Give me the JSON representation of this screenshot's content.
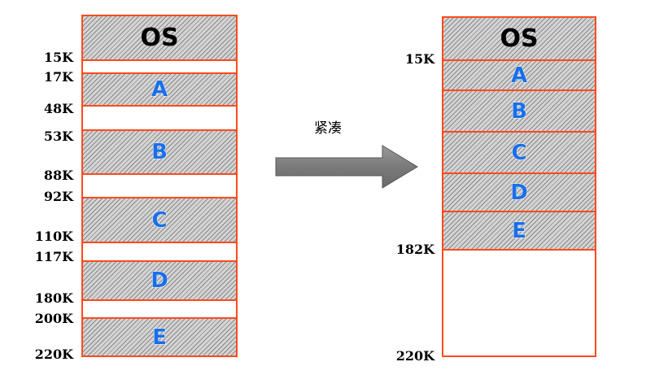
{
  "left_memory": {
    "blocks": [
      {
        "label": "OS",
        "kind": "os"
      },
      {
        "label": "",
        "kind": "free"
      },
      {
        "label": "A",
        "kind": "proc"
      },
      {
        "label": "",
        "kind": "free"
      },
      {
        "label": "B",
        "kind": "proc"
      },
      {
        "label": "",
        "kind": "free"
      },
      {
        "label": "C",
        "kind": "proc"
      },
      {
        "label": "",
        "kind": "free"
      },
      {
        "label": "D",
        "kind": "proc"
      },
      {
        "label": "",
        "kind": "free"
      },
      {
        "label": "E",
        "kind": "proc"
      }
    ],
    "addresses": [
      "15K",
      "17K",
      "48K",
      "53K",
      "88K",
      "92K",
      "110K",
      "117K",
      "180K",
      "200K",
      "220K"
    ]
  },
  "right_memory": {
    "blocks": [
      {
        "label": "OS",
        "kind": "os"
      },
      {
        "label": "A",
        "kind": "proc"
      },
      {
        "label": "B",
        "kind": "proc"
      },
      {
        "label": "C",
        "kind": "proc"
      },
      {
        "label": "D",
        "kind": "proc"
      },
      {
        "label": "E",
        "kind": "proc"
      },
      {
        "label": "",
        "kind": "free"
      }
    ],
    "addresses": [
      "15K",
      "182K",
      "220K"
    ]
  },
  "arrow": {
    "label": "紧凑",
    "icon": "right-arrow-icon"
  },
  "colors": {
    "border": "#ff4a1c",
    "process_text": "#1a6fe8",
    "arrow_fill": "#808080"
  }
}
